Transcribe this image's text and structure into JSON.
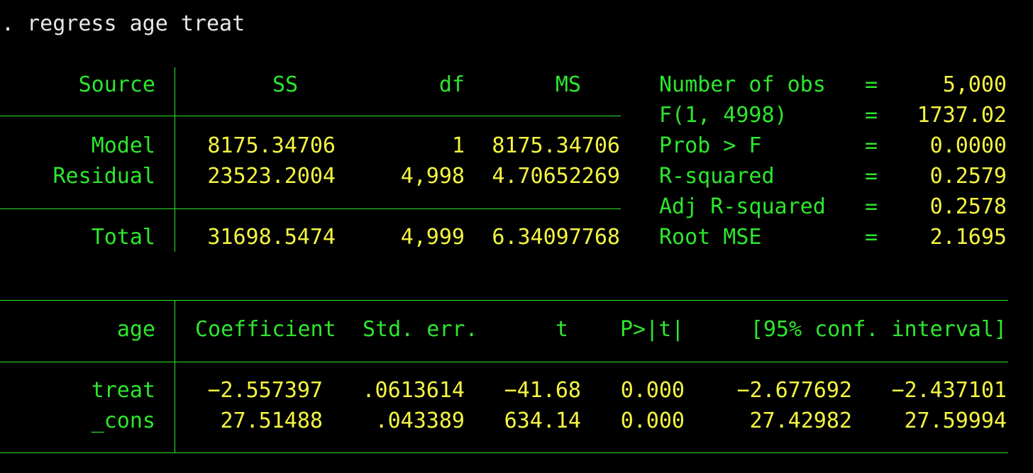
{
  "command": ". regress age treat",
  "anova": {
    "headers": {
      "source": "Source",
      "ss": "SS",
      "df": "df",
      "ms": "MS"
    },
    "rows": [
      {
        "source": "Model",
        "ss": "8175.34706",
        "df": "1",
        "ms": "8175.34706"
      },
      {
        "source": "Residual",
        "ss": "23523.2004",
        "df": "4,998",
        "ms": "4.70652269"
      },
      {
        "source": "Total",
        "ss": "31698.5474",
        "df": "4,999",
        "ms": "6.34097768"
      }
    ]
  },
  "stats": [
    {
      "label": "Number of obs",
      "eq": "=",
      "value": "5,000"
    },
    {
      "label": "F(1, 4998)",
      "eq": "=",
      "value": "1737.02"
    },
    {
      "label": "Prob > F",
      "eq": "=",
      "value": "0.0000"
    },
    {
      "label": "R-squared",
      "eq": "=",
      "value": "0.2579"
    },
    {
      "label": "Adj R-squared",
      "eq": "=",
      "value": "0.2578"
    },
    {
      "label": "Root MSE",
      "eq": "=",
      "value": "2.1695"
    }
  ],
  "coef": {
    "headers": {
      "depvar": "age",
      "coef": "Coefficient",
      "se": "Std. err.",
      "t": "t",
      "p": "P>|t|",
      "ci": "[95% conf. interval]"
    },
    "rows": [
      {
        "var": "treat",
        "coef": "−2.557397",
        "se": ".0613614",
        "t": "−41.68",
        "p": "0.000",
        "ci_low": "−2.677692",
        "ci_high": "−2.437101"
      },
      {
        "var": "_cons",
        "coef": "27.51488",
        "se": ".043389",
        "t": "634.14",
        "p": "0.000",
        "ci_low": "27.42982",
        "ci_high": "27.59994"
      }
    ]
  },
  "colors": {
    "background": "#000000",
    "text_green": "#2ee62e",
    "text_yellow": "#f5f542",
    "text_white": "#e8e8e8"
  }
}
